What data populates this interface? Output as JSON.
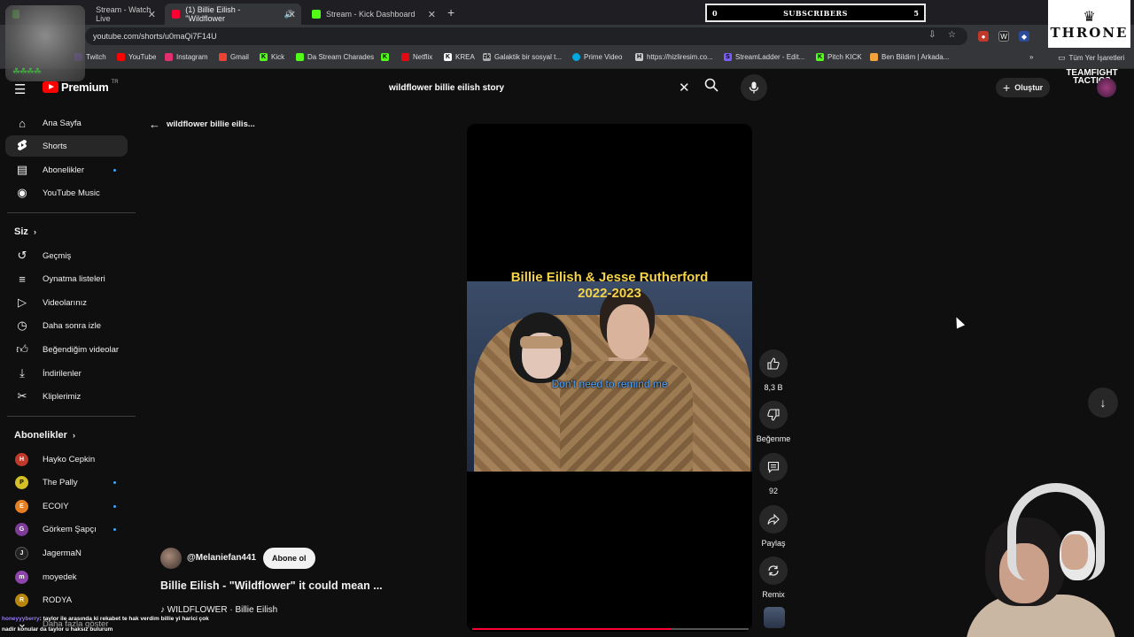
{
  "browser": {
    "tabs": [
      {
        "label": "Stream - Watch Live",
        "color": "#53fc18"
      },
      {
        "label": "(1) Billie Eilish - \"Wildflower",
        "color": "#ff0033"
      },
      {
        "label": "Stream - Kick Dashboard",
        "color": "#53fc18"
      }
    ],
    "url": "youtube.com/shorts/u0maQi7F14U",
    "bookmarks": [
      {
        "label": "Twitch",
        "color": "#9146ff"
      },
      {
        "label": "YouTube",
        "color": "#ff0000"
      },
      {
        "label": "Instagram",
        "color": "#e1306c"
      },
      {
        "label": "Gmail",
        "color": "#ea4335"
      },
      {
        "label": "Kick",
        "color": "#53fc18"
      },
      {
        "label": "Da Stream Charades",
        "color": "#53fc18"
      },
      {
        "label": "Netflix",
        "color": "#e50914"
      },
      {
        "label": "KREA",
        "color": "#ffffff"
      },
      {
        "label": "Galaktik bir sosyal t...",
        "color": "#aaaaaa"
      },
      {
        "label": "Prime Video",
        "color": "#00a8e1"
      },
      {
        "label": "https://hizliresim.co...",
        "color": "#cccccc"
      },
      {
        "label": "StreamLadder - Edit...",
        "color": "#7b5cff"
      },
      {
        "label": "Pitch KICK",
        "color": "#53fc18"
      },
      {
        "label": "Ben Bildim | Arkada...",
        "color": "#f2a33a"
      }
    ],
    "all_bookmarks": "Tüm Yer İşaretleri"
  },
  "overlay": {
    "subscribers_count_left": "0",
    "subscribers_label": "SUBSCRIBERS",
    "subscribers_count_right": "5",
    "throne_brand": "THRONE",
    "tft_brand": "TEAMFIGHT TACTICS",
    "chat": [
      {
        "nick": "honeyyyberry",
        "text": ": taylor ile arasında ki rekabet te hak verdim billie yi harici çok"
      },
      {
        "nick": "",
        "text": "nadir konular da taylor u haksız bulurum"
      }
    ]
  },
  "youtube": {
    "logo_text": "Premium",
    "logo_tr": "TR",
    "search_value": "wildflower billie eilish story",
    "create_label": "Oluştur",
    "sidebar": {
      "main": [
        {
          "label": "Ana Sayfa",
          "icon": "home-icon"
        },
        {
          "label": "Shorts",
          "icon": "shorts-icon"
        },
        {
          "label": "Abonelikler",
          "icon": "subscriptions-icon"
        },
        {
          "label": "YouTube Music",
          "icon": "music-icon"
        }
      ],
      "you_heading": "Siz",
      "you": [
        {
          "label": "Geçmiş",
          "icon": "history-icon"
        },
        {
          "label": "Oynatma listeleri",
          "icon": "playlist-icon"
        },
        {
          "label": "Videolarınız",
          "icon": "videos-icon"
        },
        {
          "label": "Daha sonra izle",
          "icon": "watch-later-icon"
        },
        {
          "label": "Beğendiğim videolar",
          "icon": "like-icon"
        },
        {
          "label": "İndirilenler",
          "icon": "download-icon"
        },
        {
          "label": "Kliplerimiz",
          "icon": "clips-icon"
        }
      ],
      "subs_heading": "Abonelikler",
      "subscriptions": [
        {
          "label": "Hayko Cepkin",
          "color": "#c0392b",
          "initial": "H"
        },
        {
          "label": "The Pally",
          "color": "#d4c026",
          "initial": "P"
        },
        {
          "label": "ECOIY",
          "color": "#e67e22",
          "initial": "E"
        },
        {
          "label": "Görkem Şapçı",
          "color": "#7d3c98",
          "initial": "G"
        },
        {
          "label": "JagermaN",
          "color": "#222222",
          "initial": "J"
        },
        {
          "label": "moyedek",
          "color": "#8e44ad",
          "initial": "m"
        },
        {
          "label": "RODYA",
          "color": "#b8860b",
          "initial": "R"
        }
      ],
      "show_more": "Daha fazla göster"
    },
    "back_label": "wildflower billie eilis...",
    "short": {
      "overlay_title_1": "Billie Eilish & Jesse Rutherford",
      "overlay_title_2": "2022-2023",
      "subtitle": "Don't need to remind me",
      "progress": 0.72,
      "channel": "@Melaniefan441",
      "subscribe_label": "Abone ol",
      "title": "Billie Eilish - \"Wildflower\" it could mean ...",
      "music": "♪ WILDFLOWER · Billie Eilish"
    },
    "actions": [
      {
        "icon": "like-icon",
        "label": "8,3 B"
      },
      {
        "icon": "dislike-icon",
        "label": "Beğenme"
      },
      {
        "icon": "comment-icon",
        "label": "92"
      },
      {
        "icon": "share-icon",
        "label": "Paylaş"
      },
      {
        "icon": "remix-icon",
        "label": "Remix"
      }
    ]
  }
}
